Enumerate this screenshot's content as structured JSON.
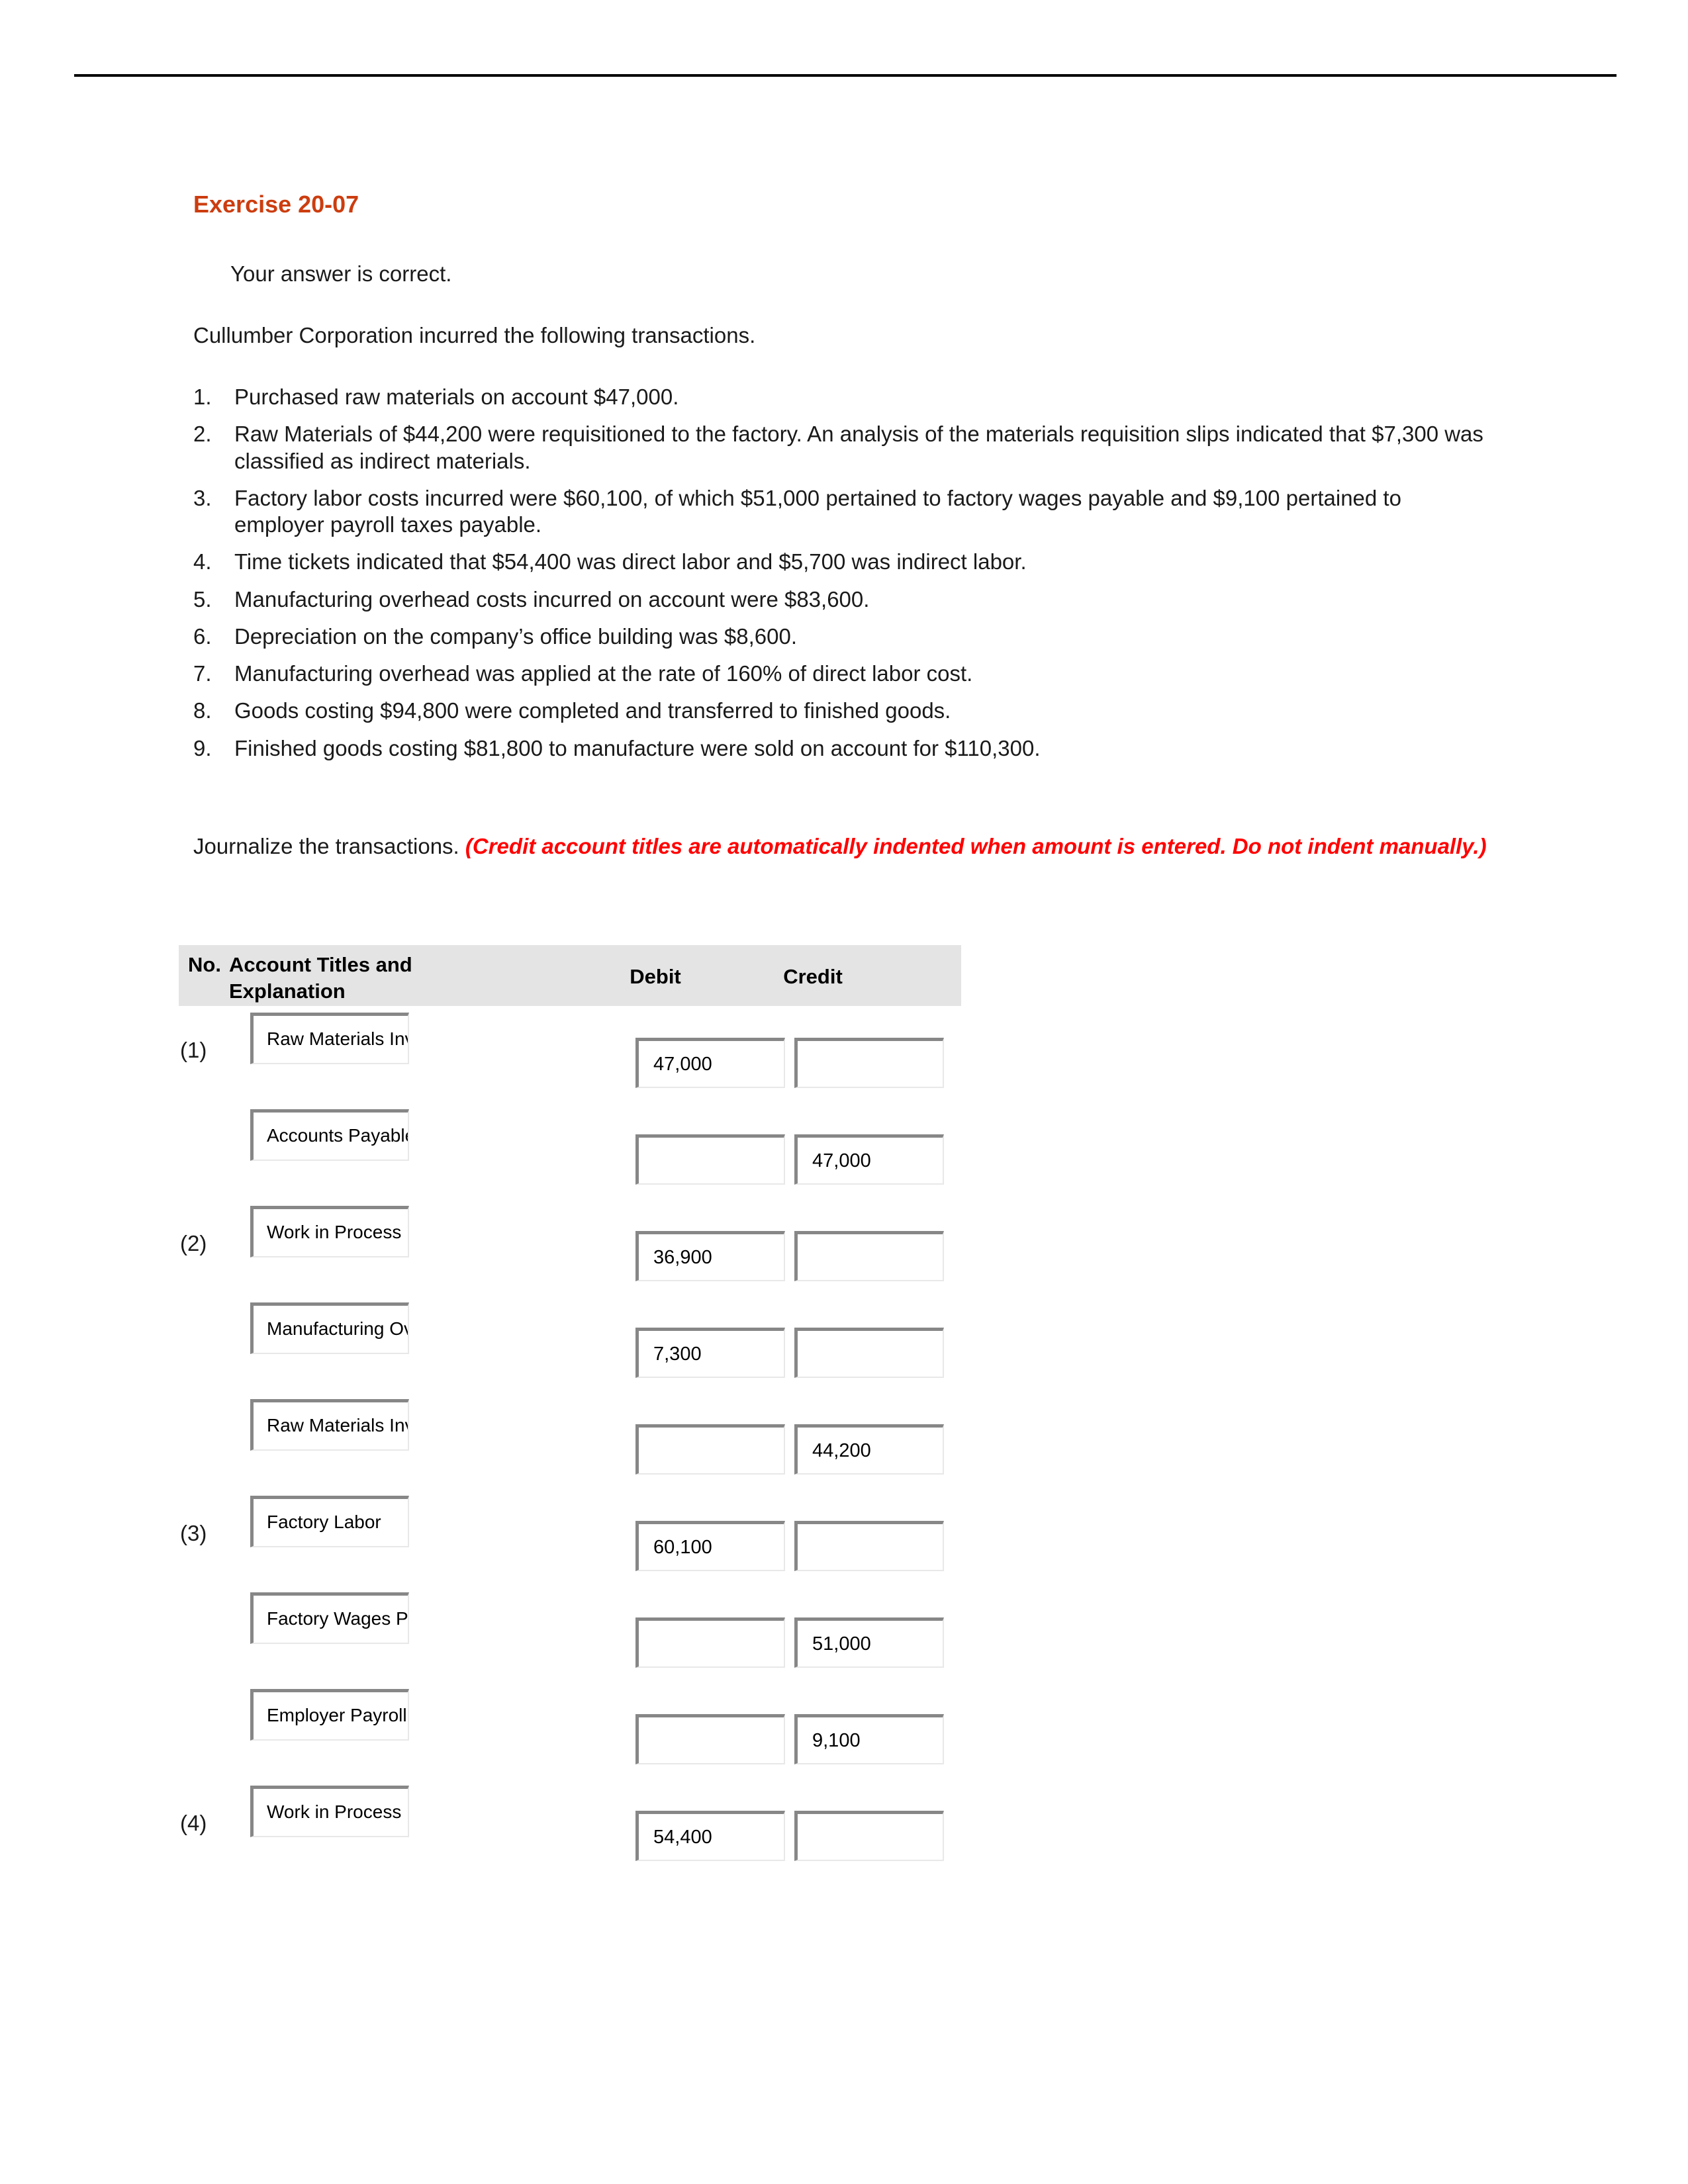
{
  "header": {
    "exercise_title": "Exercise 20-07",
    "answer_status": "Your answer is correct.",
    "intro": "Cullumber Corporation incurred the following transactions."
  },
  "transactions": [
    {
      "num": "1.",
      "text": "Purchased raw materials on account $47,000."
    },
    {
      "num": "2.",
      "text": "Raw Materials of $44,200 were requisitioned to the factory. An analysis of the materials requisition slips indicated that $7,300 was classified as indirect materials."
    },
    {
      "num": "3.",
      "text": "Factory labor costs incurred were $60,100, of which $51,000 pertained to factory wages payable and $9,100 pertained to employer payroll taxes payable."
    },
    {
      "num": "4.",
      "text": "Time tickets indicated that $54,400 was direct labor and $5,700 was indirect labor."
    },
    {
      "num": "5.",
      "text": "Manufacturing overhead costs incurred on account were $83,600."
    },
    {
      "num": "6.",
      "text": "Depreciation on the company’s office building was $8,600."
    },
    {
      "num": "7.",
      "text": "Manufacturing overhead was applied at the rate of 160% of direct labor cost."
    },
    {
      "num": "8.",
      "text": "Goods costing $94,800 were completed and transferred to finished goods."
    },
    {
      "num": "9.",
      "text": "Finished goods costing $81,800 to manufacture were sold on account for $110,300."
    }
  ],
  "journalize": {
    "lead": "Journalize the transactions. ",
    "emphasis": "(Credit account titles are automatically indented when amount is entered. Do not indent manually.)"
  },
  "journal": {
    "columns": {
      "no": "No.",
      "account": "Account Titles and Explanation",
      "debit": "Debit",
      "credit": "Credit"
    },
    "rows": [
      {
        "no": "(1)",
        "account": "Raw Materials Inventory",
        "debit": "47,000",
        "credit": ""
      },
      {
        "no": "",
        "account": "Accounts Payable",
        "debit": "",
        "credit": "47,000"
      },
      {
        "no": "(2)",
        "account": "Work in Process Inventory",
        "debit": "36,900",
        "credit": ""
      },
      {
        "no": "",
        "account": "Manufacturing Overhead",
        "debit": "7,300",
        "credit": ""
      },
      {
        "no": "",
        "account": "Raw Materials Inventory",
        "debit": "",
        "credit": "44,200"
      },
      {
        "no": "(3)",
        "account": "Factory Labor",
        "debit": "60,100",
        "credit": ""
      },
      {
        "no": "",
        "account": "Factory Wages Payable",
        "debit": "",
        "credit": "51,000"
      },
      {
        "no": "",
        "account": "Employer Payroll Taxes Payable",
        "debit": "",
        "credit": "9,100"
      },
      {
        "no": "(4)",
        "account": "Work in Process Inventory",
        "debit": "54,400",
        "credit": ""
      }
    ]
  },
  "colors": {
    "title": "#cc3d0f",
    "emphasis": "#ff0000",
    "header_bg": "#e4e4e4",
    "field_border_dark": "#878787"
  }
}
